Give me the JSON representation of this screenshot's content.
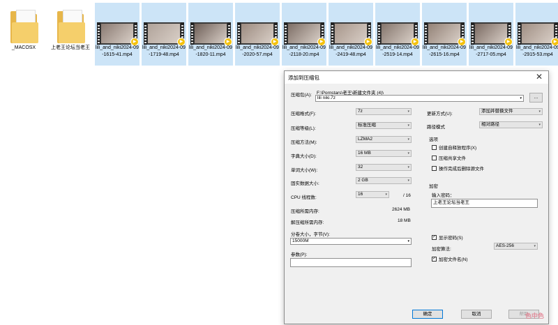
{
  "files": [
    {
      "label": "_MACOSX",
      "type": "folder",
      "icon": "folder-icon"
    },
    {
      "label": "上老王论坛当老王",
      "type": "folder",
      "icon": "folder-icon"
    },
    {
      "label": "lili_and_niki2024-09-1615-41.mp4",
      "type": "video",
      "icon": "video-thumbnail"
    },
    {
      "label": "lili_and_niki2024-09-1719-48.mp4",
      "type": "video",
      "icon": "video-thumbnail"
    },
    {
      "label": "lili_and_niki2024-09-1820-11.mp4",
      "type": "video",
      "icon": "video-thumbnail"
    },
    {
      "label": "lili_and_niki2024-09-2020-57.mp4",
      "type": "video",
      "icon": "video-thumbnail"
    },
    {
      "label": "lili_and_niki2024-09-2118-20.mp4",
      "type": "video",
      "icon": "video-thumbnail"
    },
    {
      "label": "lili_and_niki2024-09-2419-48.mp4",
      "type": "video",
      "icon": "video-thumbnail"
    },
    {
      "label": "lili_and_niki2024-09-2519-14.mp4",
      "type": "video",
      "icon": "video-thumbnail"
    },
    {
      "label": "lili_and_niki2024-09-2615-16.mp4",
      "type": "video",
      "icon": "video-thumbnail"
    },
    {
      "label": "lili_and_niki2024-09-2717-05.mp4",
      "type": "video",
      "icon": "video-thumbnail"
    },
    {
      "label": "lili_and_niki2024-09-2915-53.mp4",
      "type": "video",
      "icon": "video-thumbnail"
    }
  ],
  "dialog": {
    "title": "添加到压缩包",
    "close_glyph": "✕",
    "archive_label": "压缩包(A):",
    "archive_path": "F:\\Pornstars\\老王\\新建文件夹 (4)\\",
    "archive_name": "lili niki.7z",
    "browse_label": "...",
    "format_label": "压缩格式(F):",
    "format_value": "7z",
    "level_label": "压缩等级(L):",
    "level_value": "标准压缩",
    "method_label": "压缩方法(M):",
    "method_value": "LZMA2",
    "dict_label": "字典大小(D):",
    "dict_value": "16 MB",
    "word_label": "单词大小(W):",
    "word_value": "32",
    "solid_label": "固实数据大小:",
    "solid_value": "2 GB",
    "cpu_label": "CPU 线程数:",
    "cpu_value": "16",
    "cpu_total": "/ 16",
    "mem_comp_label": "压缩所需内存:",
    "mem_comp_value": "2624 MB",
    "mem_decomp_label": "解压缩所需内存:",
    "mem_decomp_value": "18 MB",
    "split_label": "分卷大小，字节(V):",
    "split_value": "15000M",
    "params_label": "参数(P):",
    "params_value": "",
    "update_label": "更新方式(U):",
    "update_value": "添加并替换文件",
    "path_label": "路径模式",
    "path_value": "相对路径",
    "options_title": "选项",
    "opt_sfx": "创建自释放程序(X)",
    "opt_sfx_checked": false,
    "opt_shared": "压缩共享文件",
    "opt_shared_checked": false,
    "opt_delete": "操作完成后删除源文件",
    "opt_delete_checked": false,
    "encrypt_title": "加密",
    "password_label": "输入密码：",
    "password_value": "上老王论坛当老王",
    "show_password": "显示密码(S)",
    "show_password_checked": true,
    "enc_method_label": "加密算法:",
    "enc_method_value": "AES-256",
    "encrypt_names": "加密文件名(N)",
    "encrypt_names_checked": true,
    "ok_label": "确定",
    "cancel_label": "取消",
    "help_label": "帮助",
    "check_glyph": "✓",
    "arrow_glyph": "▾"
  },
  "watermark": "色中色",
  "colors": {
    "selection": "#cce4f7",
    "focus": "#0078d7",
    "folder": "#e7b64a"
  }
}
